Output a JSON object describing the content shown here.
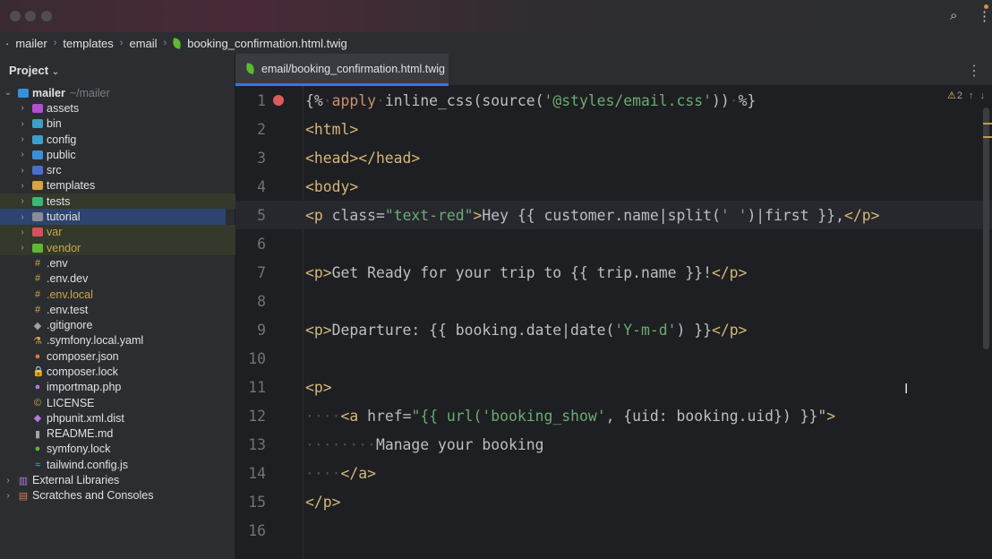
{
  "breadcrumb": [
    "mailer",
    "templates",
    "email",
    "booking_confirmation.html.twig"
  ],
  "sidebar": {
    "title": "Project",
    "root": {
      "name": "mailer",
      "path": "~/mailer"
    },
    "items": [
      {
        "label": "assets",
        "type": "folder",
        "color": "#b04fd1"
      },
      {
        "label": "bin",
        "type": "folder",
        "color": "#3aa0c9"
      },
      {
        "label": "config",
        "type": "folder",
        "color": "#3aa0c9"
      },
      {
        "label": "public",
        "type": "folder",
        "color": "#3a8fd9"
      },
      {
        "label": "src",
        "type": "folder",
        "color": "#4a6fd1"
      },
      {
        "label": "templates",
        "type": "folder",
        "color": "#d9a343"
      },
      {
        "label": "tests",
        "type": "folder",
        "color": "#3ab87a"
      },
      {
        "label": "tutorial",
        "type": "folder",
        "color": "#8a8d93"
      },
      {
        "label": "var",
        "type": "folder",
        "color": "#d94f5c"
      },
      {
        "label": "vendor",
        "type": "folder",
        "color": "#5fb832"
      },
      {
        "label": ".env",
        "type": "file",
        "icon": "#",
        "color": "#d9a343"
      },
      {
        "label": ".env.dev",
        "type": "file",
        "icon": "#",
        "color": "#d9a343"
      },
      {
        "label": ".env.local",
        "type": "file",
        "icon": "#",
        "color": "#d9a343"
      },
      {
        "label": ".env.test",
        "type": "file",
        "icon": "#",
        "color": "#d9a343"
      },
      {
        "label": ".gitignore",
        "type": "file",
        "icon": "◆",
        "color": "#a0a3a8"
      },
      {
        "label": ".symfony.local.yaml",
        "type": "file",
        "icon": "⚗",
        "color": "#d9a343"
      },
      {
        "label": "composer.json",
        "type": "file",
        "icon": "●",
        "color": "#e0733f"
      },
      {
        "label": "composer.lock",
        "type": "file",
        "icon": "🔒",
        "color": "#d94f5c"
      },
      {
        "label": "importmap.php",
        "type": "file",
        "icon": "●",
        "color": "#b07ad9"
      },
      {
        "label": "LICENSE",
        "type": "file",
        "icon": "©",
        "color": "#d9a343"
      },
      {
        "label": "phpunit.xml.dist",
        "type": "file",
        "icon": "◆",
        "color": "#b07ad9"
      },
      {
        "label": "README.md",
        "type": "file",
        "icon": "▮",
        "color": "#a0a3a8"
      },
      {
        "label": "symfony.lock",
        "type": "file",
        "icon": "●",
        "color": "#5fb832"
      },
      {
        "label": "tailwind.config.js",
        "type": "file",
        "icon": "≈",
        "color": "#3ab8c9"
      }
    ],
    "bottom": [
      {
        "label": "External Libraries",
        "icon": "▥",
        "color": "#b07ad9"
      },
      {
        "label": "Scratches and Consoles",
        "icon": "▤",
        "color": "#d97a5a"
      }
    ]
  },
  "editor": {
    "tab": "email/booking_confirmation.html.twig",
    "warnings": "2",
    "lines": [
      {
        "n": "1",
        "bp": true,
        "tokens": [
          [
            "{%",
            "delim"
          ],
          [
            "·",
            "ws"
          ],
          [
            "apply",
            "kw"
          ],
          [
            "·",
            "ws"
          ],
          [
            "inline_css(source(",
            "txt"
          ],
          [
            "'@styles/email.css'",
            "str"
          ],
          [
            "))",
            "txt"
          ],
          [
            "·",
            "ws"
          ],
          [
            "%}",
            "delim"
          ]
        ]
      },
      {
        "n": "2",
        "tokens": [
          [
            "<html>",
            "tag"
          ]
        ]
      },
      {
        "n": "3",
        "tokens": [
          [
            "<head></head>",
            "tag"
          ]
        ]
      },
      {
        "n": "4",
        "tokens": [
          [
            "<body>",
            "tag"
          ]
        ]
      },
      {
        "n": "5",
        "cur": true,
        "tokens": [
          [
            "<p",
            "tag"
          ],
          [
            " class=",
            "attr"
          ],
          [
            "\"text-red\"",
            "str"
          ],
          [
            ">",
            "tag"
          ],
          [
            "Hey {{ customer.name|split(",
            "txt"
          ],
          [
            "' '",
            "str"
          ],
          [
            ")|first }},",
            "txt"
          ],
          [
            "</p>",
            "tag"
          ]
        ]
      },
      {
        "n": "6",
        "tokens": []
      },
      {
        "n": "7",
        "tokens": [
          [
            "<p>",
            "tag"
          ],
          [
            "Get Ready for your trip to {{ trip.name }}!",
            "txt"
          ],
          [
            "</p>",
            "tag"
          ]
        ]
      },
      {
        "n": "8",
        "tokens": []
      },
      {
        "n": "9",
        "tokens": [
          [
            "<p>",
            "tag"
          ],
          [
            "Departure: {{ booking.date|date(",
            "txt"
          ],
          [
            "'Y-m-d'",
            "str"
          ],
          [
            ") }}",
            "txt"
          ],
          [
            "</p>",
            "tag"
          ]
        ]
      },
      {
        "n": "10",
        "tokens": []
      },
      {
        "n": "11",
        "tokens": [
          [
            "<p>",
            "tag"
          ]
        ]
      },
      {
        "n": "12",
        "tokens": [
          [
            "····",
            "ws"
          ],
          [
            "<a",
            "tag"
          ],
          [
            " href=",
            "attr"
          ],
          [
            "\"{{ url(",
            "str"
          ],
          [
            "'booking_show'",
            "str"
          ],
          [
            ", {uid: booking.uid}) }}\"",
            "txt"
          ],
          [
            ">",
            "tag"
          ]
        ]
      },
      {
        "n": "13",
        "tokens": [
          [
            "········",
            "ws"
          ],
          [
            "Manage your booking",
            "txt"
          ]
        ]
      },
      {
        "n": "14",
        "tokens": [
          [
            "····",
            "ws"
          ],
          [
            "</a>",
            "tag"
          ]
        ]
      },
      {
        "n": "15",
        "tokens": [
          [
            "</p>",
            "tag"
          ]
        ]
      },
      {
        "n": "16",
        "tokens": []
      }
    ]
  }
}
